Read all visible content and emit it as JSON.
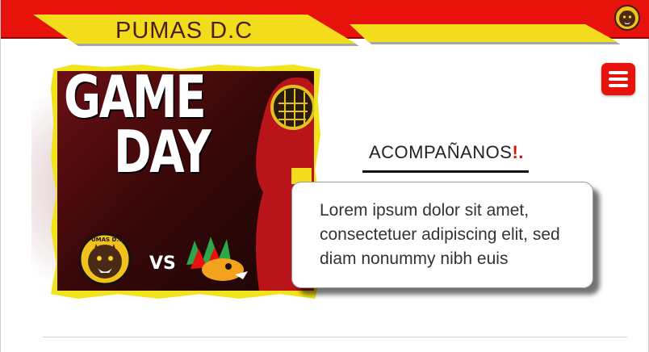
{
  "header": {
    "title": "PUMAS D.C",
    "logo_icon": "puma-logo-icon",
    "menu_icon": "hamburger-menu-icon"
  },
  "poster": {
    "line1": "GAME",
    "line2": "DAY",
    "vs": "VS",
    "team_logo_text": "PUMAS D.C"
  },
  "main": {
    "accompany_prefix": "ACOMPAÑANOS",
    "accompany_suffix": "!.",
    "lorem": "Lorem ipsum dolor sit amet, consectetuer adipiscing elit, sed diam nonummy nibh euis"
  },
  "colors": {
    "header_red": "#e8120c",
    "banner_yellow": "#f2dc1c",
    "text_dark": "#333333"
  }
}
